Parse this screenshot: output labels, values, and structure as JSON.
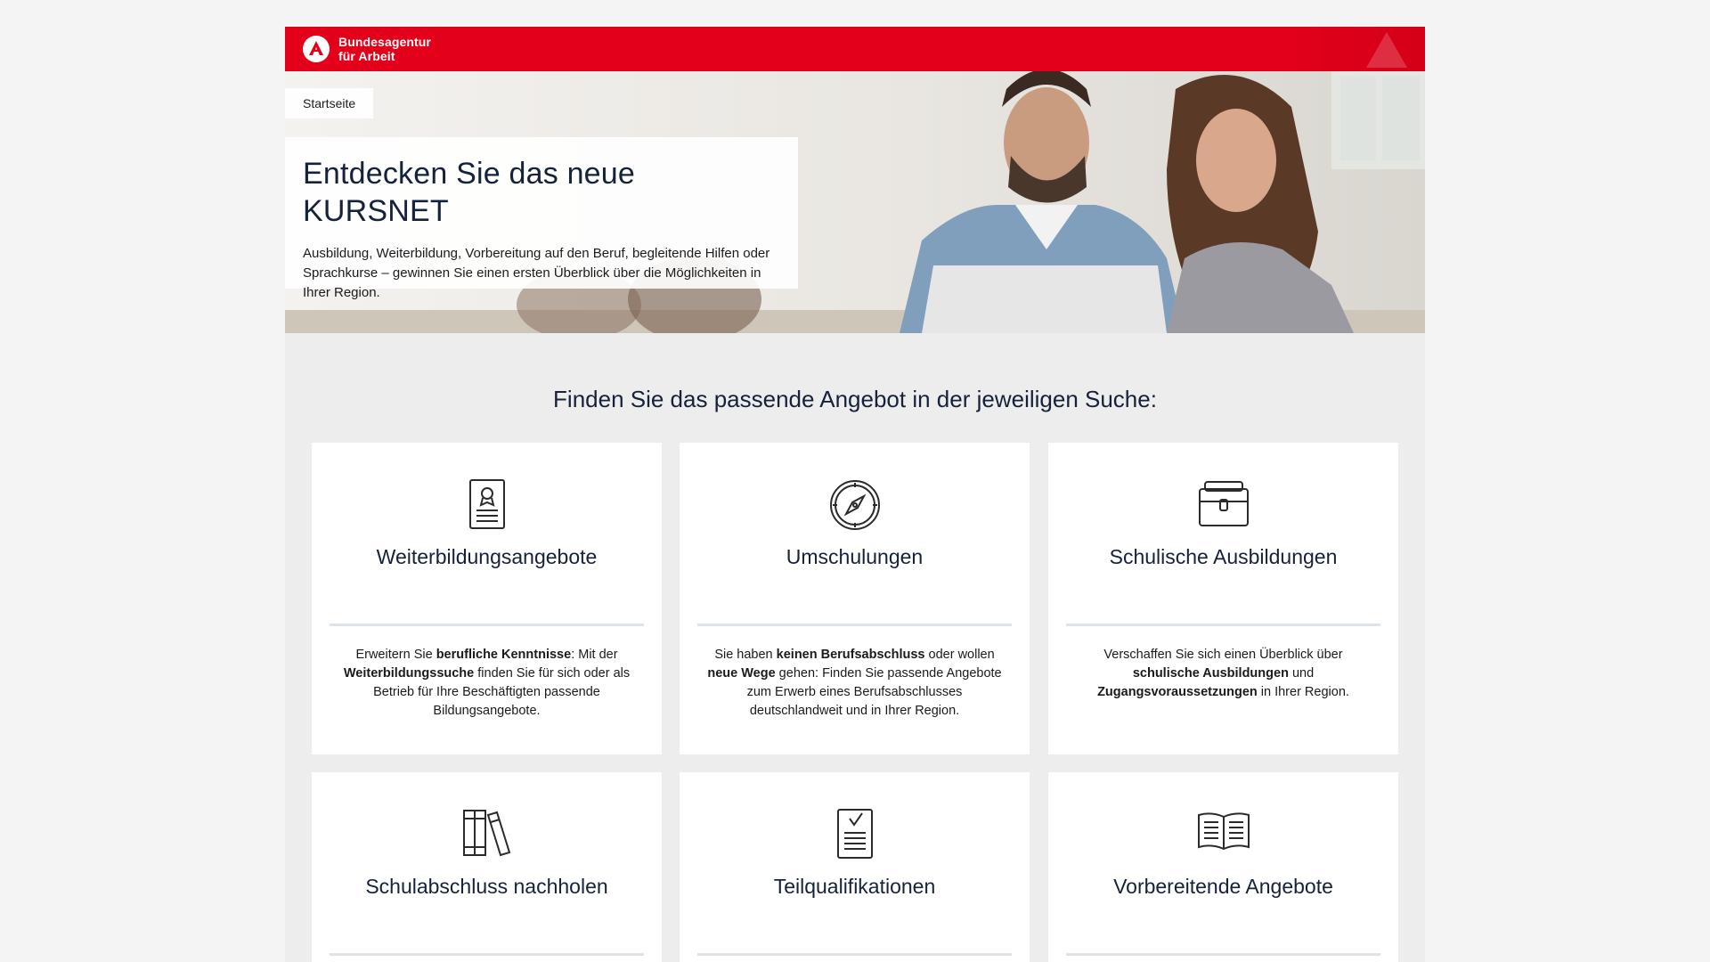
{
  "header": {
    "logo_line1": "Bundesagentur",
    "logo_line2": "für Arbeit"
  },
  "hero": {
    "breadcrumb": "Startseite",
    "title": "Entdecken Sie das neue KURSNET",
    "description": "Ausbildung, Weiterbildung, Vorbereitung auf den Beruf, begleitende Hilfen oder Sprachkurse – gewinnen Sie einen ersten Überblick über die Möglichkeiten in Ihrer Region."
  },
  "section": {
    "title": "Finden Sie das passende Angebot in der jeweiligen Suche:"
  },
  "cards": [
    {
      "title": "Weiterbildungsangebote",
      "icon": "certificate-document-icon",
      "text_parts": [
        "Erweitern Sie ",
        "berufliche Kenntnisse",
        ": Mit der ",
        "Weiterbildungssuche",
        " finden Sie für sich oder als Betrieb für Ihre Beschäftigten passende Bildungsangebote."
      ]
    },
    {
      "title": "Umschulungen",
      "icon": "compass-icon",
      "text_parts": [
        "Sie haben ",
        "keinen Berufsabschluss",
        " oder wollen ",
        "neue Wege",
        " gehen: Finden Sie passende Angebote zum Erwerb eines Berufsabschlusses deutschlandweit und in Ihrer Region."
      ]
    },
    {
      "title": "Schulische Ausbildungen",
      "icon": "school-bag-icon",
      "text_parts": [
        "Verschaffen Sie sich einen Überblick über ",
        "schulische Ausbildungen",
        " und ",
        "Zugangsvoraussetzungen",
        " in Ihrer Region."
      ]
    },
    {
      "title": "Schulabschluss nachholen",
      "icon": "books-icon",
      "text_parts": []
    },
    {
      "title": "Teilqualifikationen",
      "icon": "checklist-document-icon",
      "text_parts": []
    },
    {
      "title": "Vorbereitende Angebote",
      "icon": "open-book-icon",
      "text_parts": []
    }
  ],
  "colors": {
    "brand_red": "#e2001a",
    "heading": "#16213a",
    "page_bg": "#f4f4f4",
    "section_bg": "#ededed"
  }
}
